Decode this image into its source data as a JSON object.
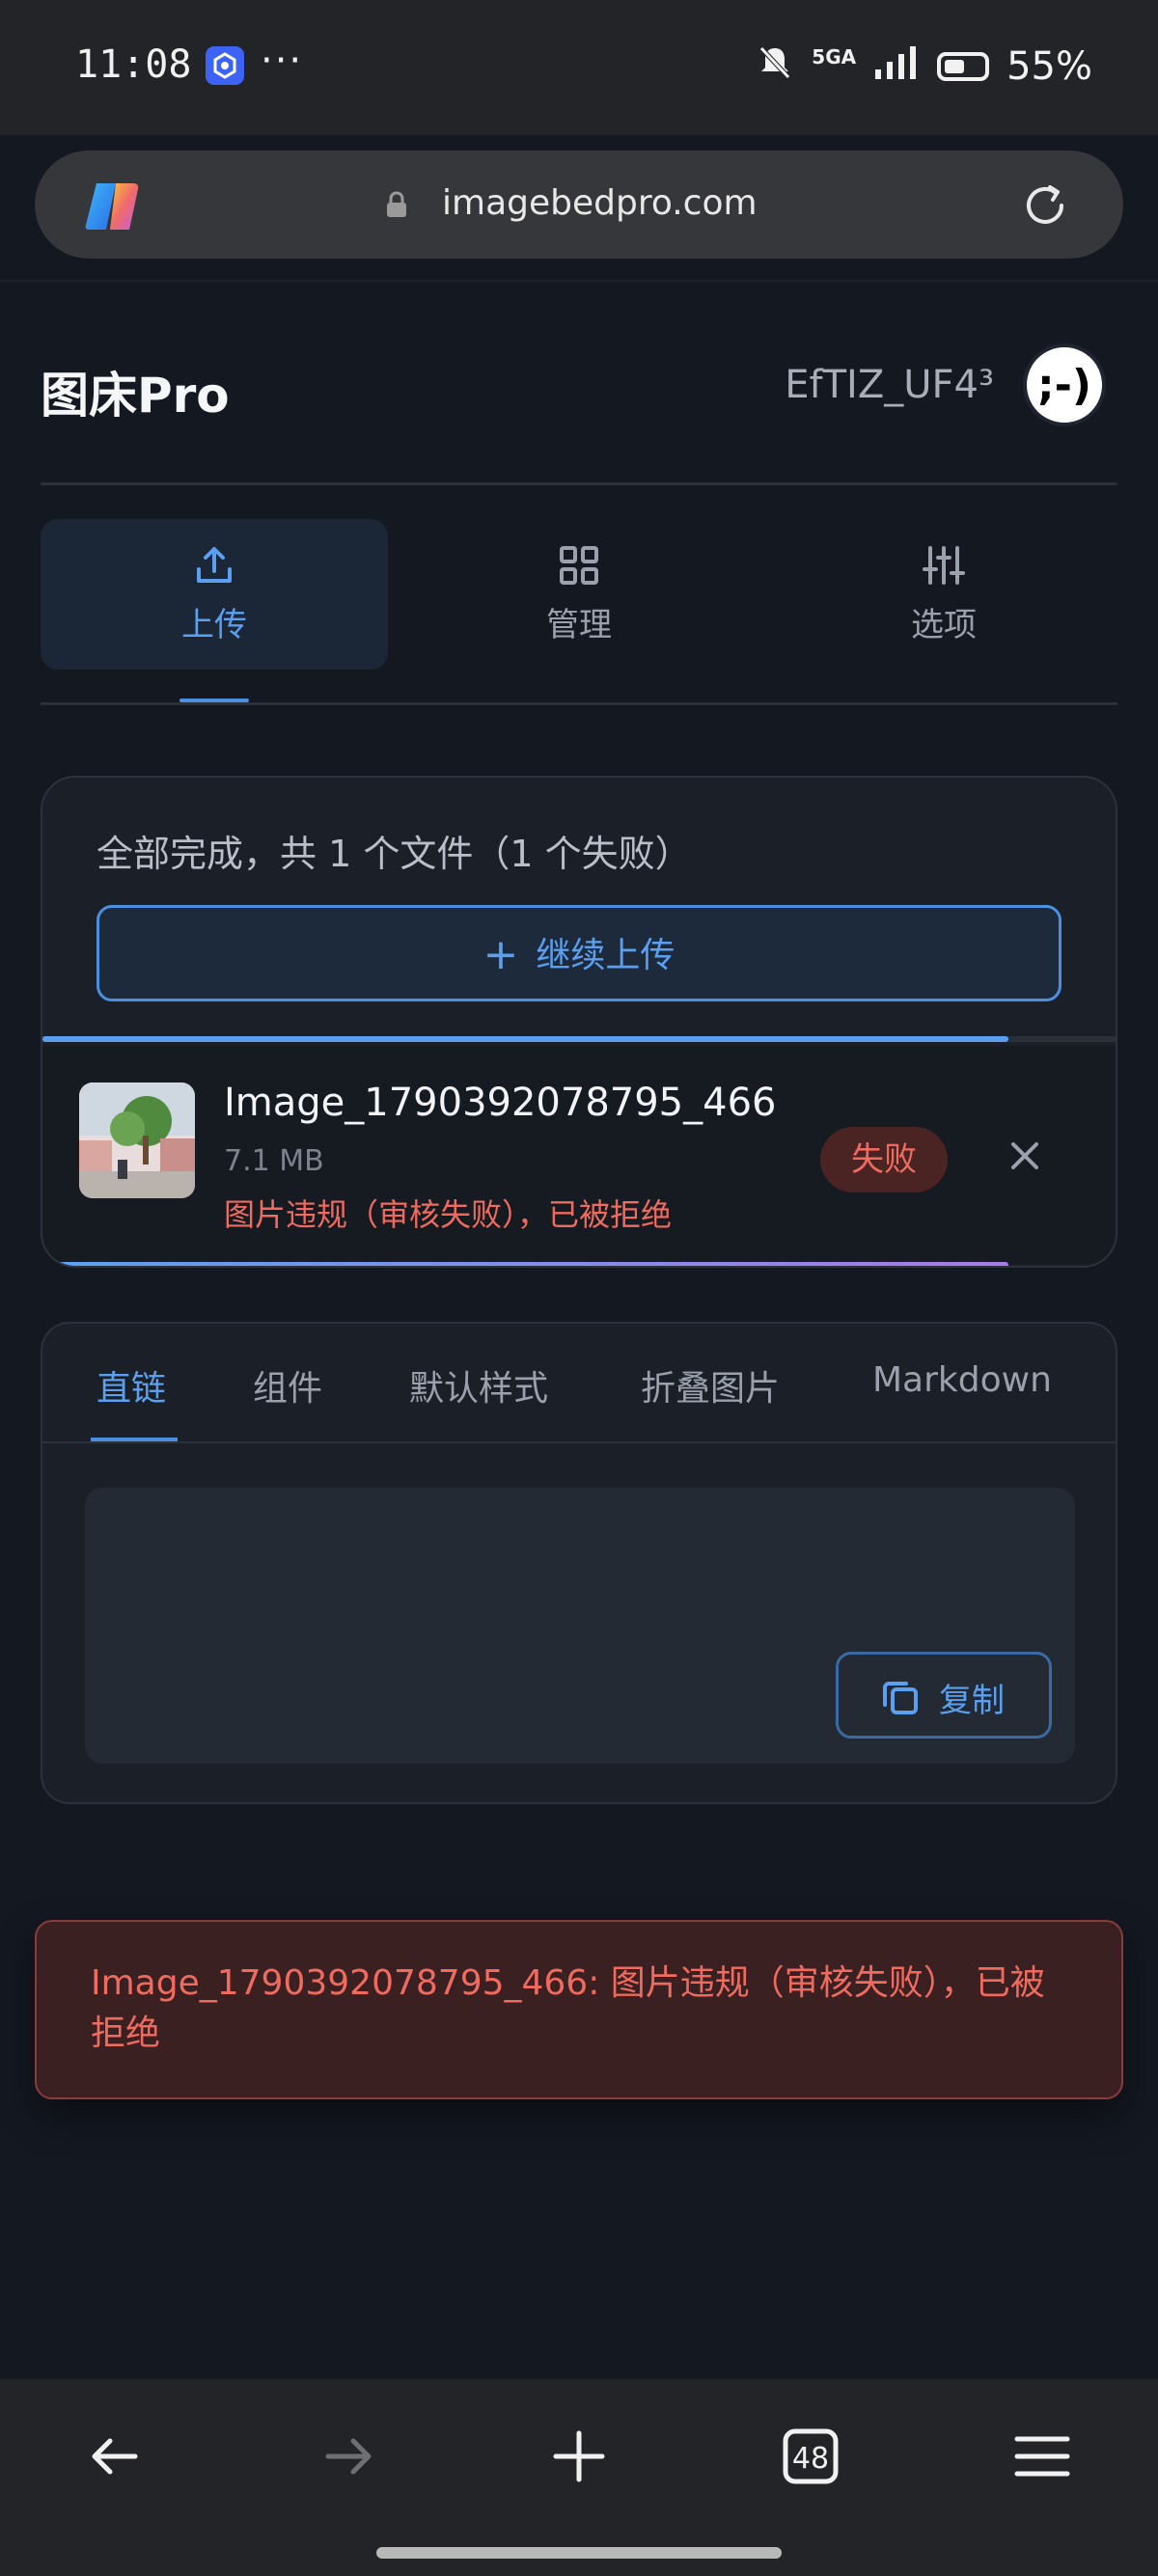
{
  "status_bar": {
    "time": "11:08",
    "more": "···",
    "network": "5GA",
    "battery": "55%",
    "battery_level": 0.55,
    "icons": [
      "app-notification-icon",
      "silent-icon",
      "signal-icon",
      "battery-icon"
    ]
  },
  "browser": {
    "url": "imagebedpro.com",
    "icons": [
      "copilot-icon",
      "lock-icon",
      "reload-icon"
    ]
  },
  "header": {
    "brand": "图床Pro",
    "username": "EfTIZ_UF4³",
    "avatar_face": ";-)"
  },
  "nav": {
    "tabs": [
      {
        "label": "上传",
        "icon": "upload-icon",
        "active": true
      },
      {
        "label": "管理",
        "icon": "grid-icon",
        "active": false
      },
      {
        "label": "选项",
        "icon": "sliders-icon",
        "active": false
      }
    ]
  },
  "upload": {
    "summary": "全部完成，共 1 个文件（1 个失败）",
    "continue_label": "继续上传",
    "progress": 0.9,
    "file": {
      "name": "Image_1790392078795_466",
      "size": "7.1 MB",
      "error": "图片违规（审核失败），已被拒绝",
      "status": "失败",
      "progress": 0.9
    }
  },
  "formats": {
    "tabs": [
      "直链",
      "组件",
      "默认样式",
      "折叠图片",
      "Markdown"
    ],
    "active": "直链",
    "copy_label": "复制"
  },
  "toast": {
    "message": "Image_1790392078795_466: 图片违规（审核失败），已被拒绝"
  },
  "bottom_nav": {
    "tabs_count": "48",
    "icons": [
      "back-icon",
      "forward-icon",
      "new-tab-icon",
      "tabs-icon",
      "menu-icon"
    ]
  },
  "colors": {
    "accent": "#5ba0f0",
    "error": "#ef6a5f",
    "background": "#141821"
  }
}
